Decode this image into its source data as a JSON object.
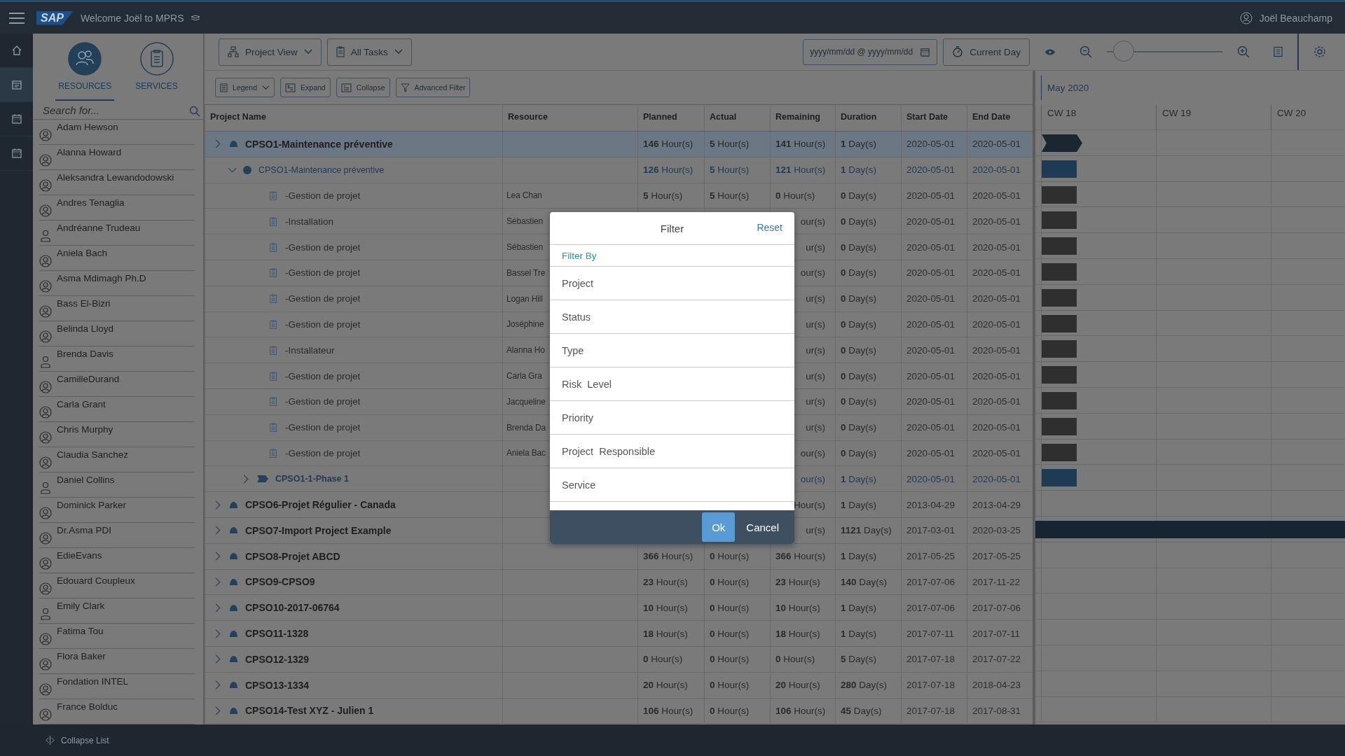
{
  "topbar": {
    "logo": "SAP",
    "welcome": "Welcome Joël to MPRS",
    "user": "Joël Beauchamp"
  },
  "nav": [
    {
      "kind": "home",
      "selected": false
    },
    {
      "kind": "planner",
      "selected": true
    },
    {
      "kind": "calendar",
      "selected": false
    },
    {
      "kind": "calendar",
      "selected": false
    }
  ],
  "panel": {
    "tabs": [
      {
        "label": "RESOURCES",
        "kind": "people",
        "selected": true
      },
      {
        "label": "SERVICES",
        "kind": "clipboard",
        "selected": false
      }
    ],
    "search": {
      "placeholder": "Search for..."
    },
    "items": [
      {
        "name": "Adam Hewson",
        "kind": "account"
      },
      {
        "name": "Alanna Howard",
        "kind": "account"
      },
      {
        "name": "Aleksandra Lewandodowski",
        "kind": "account"
      },
      {
        "name": "Andres Tenaglia",
        "kind": "account"
      },
      {
        "name": "Andréanne Trudeau",
        "kind": "user"
      },
      {
        "name": "Aniela Bach",
        "kind": "account"
      },
      {
        "name": "Asma Mdimagh Ph.D",
        "kind": "account"
      },
      {
        "name": "Bass El-Bizri",
        "kind": "account"
      },
      {
        "name": "Belinda Lloyd",
        "kind": "account"
      },
      {
        "name": "Brenda Davis",
        "kind": "user"
      },
      {
        "name": "CamilleDurand",
        "kind": "account"
      },
      {
        "name": "Carla Grant",
        "kind": "account"
      },
      {
        "name": "Chris Murphy",
        "kind": "account"
      },
      {
        "name": "Claudia Sanchez",
        "kind": "account"
      },
      {
        "name": "Daniel Collins",
        "kind": "user"
      },
      {
        "name": "Dominick Parker",
        "kind": "account"
      },
      {
        "name": "Dr.Asma PDI",
        "kind": "account"
      },
      {
        "name": "EdieEvans",
        "kind": "account"
      },
      {
        "name": "Edouard Coupleux",
        "kind": "account"
      },
      {
        "name": "Emily Clark",
        "kind": "user"
      },
      {
        "name": "Fatima Tou",
        "kind": "account"
      },
      {
        "name": "Flora Baker",
        "kind": "account"
      },
      {
        "name": "Fondation INTEL",
        "kind": "account"
      },
      {
        "name": "France Bolduc",
        "kind": "account"
      }
    ]
  },
  "toolbar": {
    "view": "Project View",
    "tasks": "All Tasks",
    "date_range": {
      "placeholder": "yyyy/mm/dd @ yyyy/mm/dd"
    },
    "current_day": "Current Day",
    "zoom": {
      "level": 0.08
    },
    "legend": "Legend",
    "expand": "Expand",
    "collapse": "Collapse",
    "advanced_filter": "Advanced Filter"
  },
  "table": {
    "columns": [
      "Project Name",
      "Resource",
      "Planned",
      "Actual",
      "Remaining",
      "Duration",
      "Start Date",
      "End Date"
    ],
    "rows": [
      {
        "name": "CPSO1-Maintenance préventive",
        "kind": "project",
        "expanded": false,
        "selected": true,
        "planned": "**146** Hour(s)",
        "actual": "**5** Hour(s)",
        "remaining": "**141** Hour(s)",
        "duration": "**1** Day(s)",
        "start": "2020-05-01",
        "end": "2020-05-01",
        "bar": {
          "kind": "summary"
        },
        "children": [
          {
            "name": "CPSO1-Maintenance préventive",
            "kind": "stage",
            "expanded": true,
            "planned": "**126** Hour(s)",
            "actual": "**5** Hour(s)",
            "remaining": "**121** Hour(s)",
            "duration": "**1** Day(s)",
            "start": "2020-05-01",
            "end": "2020-05-01",
            "bar": {
              "kind": "phase"
            },
            "children": [
              {
                "name": "-Gestion de projet",
                "kind": "task",
                "resource": "Lea Chan",
                "planned": "**5** Hour(s)",
                "actual": "**5** Hour(s)",
                "remaining": "**0** Hour(s)",
                "duration": "**0** Day(s)",
                "start": "2020-05-01",
                "end": "2020-05-01",
                "bar": {
                  "kind": "task"
                }
              },
              {
                "name": "-Installation",
                "kind": "task",
                "resource": "Sébastien",
                "remaining": "our(s)",
                "duration": "**0** Day(s)",
                "start": "2020-05-01",
                "end": "2020-05-01",
                "bar": {
                  "kind": "task"
                }
              },
              {
                "name": "-Gestion de projet",
                "kind": "task",
                "resource": "Sébastien",
                "remaining": "ur(s)",
                "duration": "**0** Day(s)",
                "start": "2020-05-01",
                "end": "2020-05-01",
                "bar": {
                  "kind": "task"
                }
              },
              {
                "name": "-Gestion de projet",
                "kind": "task",
                "resource": "Bassel Tre",
                "remaining": "our(s)",
                "duration": "**0** Day(s)",
                "start": "2020-05-01",
                "end": "2020-05-01",
                "bar": {
                  "kind": "task"
                }
              },
              {
                "name": "-Gestion de projet",
                "kind": "task",
                "resource": "Logan Hill",
                "remaining": "ur(s)",
                "duration": "**0** Day(s)",
                "start": "2020-05-01",
                "end": "2020-05-01",
                "bar": {
                  "kind": "task"
                }
              },
              {
                "name": "-Gestion de projet",
                "kind": "task",
                "resource": "Joséphine",
                "remaining": "ur(s)",
                "duration": "**0** Day(s)",
                "start": "2020-05-01",
                "end": "2020-05-01",
                "bar": {
                  "kind": "task"
                }
              },
              {
                "name": "-Installateur",
                "kind": "task",
                "resource": "Alanna Ho",
                "remaining": "ur(s)",
                "duration": "**0** Day(s)",
                "start": "2020-05-01",
                "end": "2020-05-01",
                "bar": {
                  "kind": "task"
                }
              },
              {
                "name": "-Gestion de projet",
                "kind": "task",
                "resource": "Carla Gra",
                "remaining": "ur(s)",
                "duration": "**0** Day(s)",
                "start": "2020-05-01",
                "end": "2020-05-01",
                "bar": {
                  "kind": "task"
                }
              },
              {
                "name": "-Gestion de projet",
                "kind": "task",
                "resource": "Jacqueline",
                "remaining": "ur(s)",
                "duration": "**0** Day(s)",
                "start": "2020-05-01",
                "end": "2020-05-01",
                "bar": {
                  "kind": "task"
                }
              },
              {
                "name": "-Gestion de projet",
                "kind": "task",
                "resource": "Brenda Da",
                "remaining": "ur(s)",
                "duration": "**0** Day(s)",
                "start": "2020-05-01",
                "end": "2020-05-01",
                "bar": {
                  "kind": "task"
                }
              },
              {
                "name": "-Gestion de projet",
                "kind": "task",
                "resource": "Aniela Bac",
                "remaining": "our(s)",
                "duration": "**0** Day(s)",
                "start": "2020-05-01",
                "end": "2020-05-01",
                "bar": {
                  "kind": "task"
                }
              },
              {
                "name": "CPSO1-1-Phase 1",
                "kind": "phase",
                "expanded": false,
                "remaining": "our(s)",
                "duration": "**1** Day(s)",
                "start": "2020-05-01",
                "end": "2020-05-01",
                "bar": {
                  "kind": "phase"
                }
              }
            ]
          }
        ]
      },
      {
        "name": "CPSO6-Projet Régulier - Canada",
        "kind": "project",
        "expanded": false,
        "selected": false,
        "remaining": "Hour(s)",
        "duration": "**1** Day(s)",
        "start": "2013-04-29",
        "end": "2013-04-29"
      },
      {
        "name": "CPSO7-Import Project Example",
        "kind": "project",
        "expanded": false,
        "selected": false,
        "remaining": "ur(s)",
        "duration": "**1121** Day(s)",
        "start": "2017-03-01",
        "end": "2020-03-25",
        "bar": {
          "kind": "span"
        }
      },
      {
        "name": "CPSO8-Projet ABCD",
        "kind": "project",
        "expanded": false,
        "selected": false,
        "planned": "**366** Hour(s)",
        "actual": "**0** Hour(s)",
        "remaining": "**366** Hour(s)",
        "duration": "**1** Day(s)",
        "start": "2017-05-25",
        "end": "2017-05-25"
      },
      {
        "name": "CPSO9-CPSO9",
        "kind": "project",
        "expanded": false,
        "selected": false,
        "planned": "**23** Hour(s)",
        "actual": "**0** Hour(s)",
        "remaining": "**23** Hour(s)",
        "duration": "**140** Day(s)",
        "start": "2017-07-06",
        "end": "2017-11-22"
      },
      {
        "name": "CPSO10-2017-06764",
        "kind": "project",
        "expanded": false,
        "selected": false,
        "planned": "**10** Hour(s)",
        "actual": "**0** Hour(s)",
        "remaining": "**10** Hour(s)",
        "duration": "**1** Day(s)",
        "start": "2017-07-06",
        "end": "2017-07-06"
      },
      {
        "name": "CPSO11-1328",
        "kind": "project",
        "expanded": false,
        "selected": false,
        "planned": "**18** Hour(s)",
        "actual": "**0** Hour(s)",
        "remaining": "**18** Hour(s)",
        "duration": "**1** Day(s)",
        "start": "2017-07-11",
        "end": "2017-07-11"
      },
      {
        "name": "CPSO12-1329",
        "kind": "project",
        "expanded": false,
        "selected": false,
        "planned": "**0** Hour(s)",
        "actual": "**0** Hour(s)",
        "remaining": "**0** Hour(s)",
        "duration": "**5** Day(s)",
        "start": "2017-07-18",
        "end": "2017-07-22"
      },
      {
        "name": "CPSO13-1334",
        "kind": "project",
        "expanded": false,
        "selected": false,
        "planned": "**20** Hour(s)",
        "actual": "**0** Hour(s)",
        "remaining": "**20** Hour(s)",
        "duration": "**280** Day(s)",
        "start": "2017-07-18",
        "end": "2018-04-23"
      },
      {
        "name": "CPSO14-Test XYZ - Julien 1",
        "kind": "project",
        "expanded": false,
        "selected": false,
        "planned": "**106** Hour(s)",
        "actual": "**0** Hour(s)",
        "remaining": "**106** Hour(s)",
        "duration": "**45** Day(s)",
        "start": "2017-07-18",
        "end": "2017-08-31"
      }
    ]
  },
  "gantt": {
    "month": "May 2020",
    "weeks": [
      "CW 18",
      "CW 19",
      "CW 20"
    ]
  },
  "dialog": {
    "title": "Filter",
    "reset": "Reset",
    "section": "Filter By",
    "options": [
      "Project",
      "Status",
      "Type",
      "Risk  Level",
      "Priority",
      "Project  Responsible",
      "Service"
    ],
    "ok": "Ok",
    "cancel": "Cancel"
  },
  "footer": {
    "collapse": "Collapse List"
  }
}
